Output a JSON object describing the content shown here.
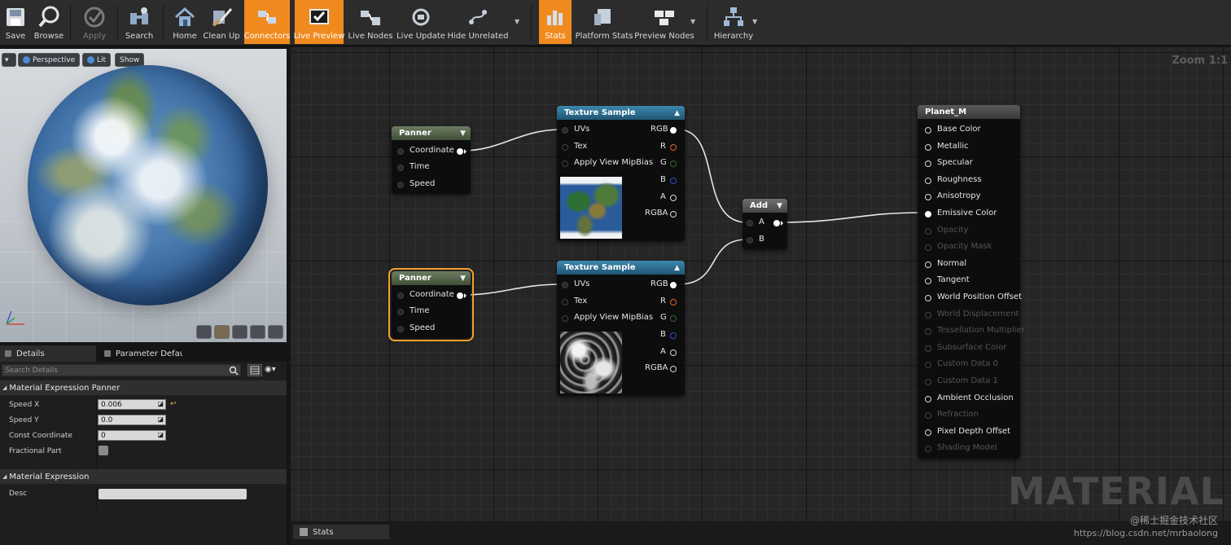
{
  "toolbar": {
    "items": [
      {
        "label": "Save",
        "icon": "save-icon"
      },
      {
        "label": "Browse",
        "icon": "browse-icon"
      },
      {
        "label": "Apply",
        "icon": "apply-icon"
      },
      {
        "label": "Search",
        "icon": "search-icon"
      },
      {
        "label": "Home",
        "icon": "home-icon"
      },
      {
        "label": "Clean Up",
        "icon": "clean-up-icon"
      },
      {
        "label": "Connectors",
        "icon": "connectors-icon"
      },
      {
        "label": "Live Preview",
        "icon": "live-preview-icon"
      },
      {
        "label": "Live Nodes",
        "icon": "live-nodes-icon"
      },
      {
        "label": "Live Update",
        "icon": "live-update-icon"
      },
      {
        "label": "Hide Unrelated",
        "icon": "hide-unrelated-icon"
      },
      {
        "label": "Stats",
        "icon": "stats-icon"
      },
      {
        "label": "Platform Stats",
        "icon": "platform-stats-icon"
      },
      {
        "label": "Preview Nodes",
        "icon": "preview-nodes-icon"
      },
      {
        "label": "Hierarchy",
        "icon": "hierarchy-icon"
      }
    ],
    "accent": "#f08a1e"
  },
  "viewport": {
    "perspective": "Perspective",
    "lit": "Lit",
    "show": "Show"
  },
  "details": {
    "tab_details": "Details",
    "tab_params": "Parameter Defaults",
    "search_placeholder": "Search Details",
    "section1": "Material Expression Panner",
    "props": [
      {
        "name": "Speed X",
        "value": "0.006"
      },
      {
        "name": "Speed Y",
        "value": "0.0"
      },
      {
        "name": "Const Coordinate",
        "value": "0"
      },
      {
        "name": "Fractional Part",
        "value": ""
      }
    ],
    "section2": "Material Expression",
    "desc_label": "Desc"
  },
  "graph": {
    "zoom": "Zoom 1:1",
    "watermark": "MATERIAL",
    "panner1": {
      "title": "Panner",
      "pins": [
        "Coordinate",
        "Time",
        "Speed"
      ]
    },
    "panner2": {
      "title": "Panner",
      "pins": [
        "Coordinate",
        "Time",
        "Speed"
      ]
    },
    "tex1": {
      "title": "Texture Sample",
      "inputs": [
        "UVs",
        "Tex",
        "Apply View MipBias"
      ],
      "outputs": [
        "RGB",
        "R",
        "G",
        "B",
        "A",
        "RGBA"
      ]
    },
    "tex2": {
      "title": "Texture Sample",
      "inputs": [
        "UVs",
        "Tex",
        "Apply View MipBias"
      ],
      "outputs": [
        "RGB",
        "R",
        "G",
        "B",
        "A",
        "RGBA"
      ]
    },
    "add": {
      "title": "Add",
      "inputs": [
        "A",
        "B"
      ]
    },
    "result": {
      "title": "Planet_M",
      "pins": [
        {
          "label": "Base Color",
          "enabled": true
        },
        {
          "label": "Metallic",
          "enabled": true
        },
        {
          "label": "Specular",
          "enabled": true
        },
        {
          "label": "Roughness",
          "enabled": true
        },
        {
          "label": "Anisotropy",
          "enabled": true
        },
        {
          "label": "Emissive Color",
          "enabled": true
        },
        {
          "label": "Opacity",
          "enabled": false
        },
        {
          "label": "Opacity Mask",
          "enabled": false
        },
        {
          "label": "Normal",
          "enabled": true
        },
        {
          "label": "Tangent",
          "enabled": true
        },
        {
          "label": "World Position Offset",
          "enabled": true
        },
        {
          "label": "World Displacement",
          "enabled": false
        },
        {
          "label": "Tessellation Multiplier",
          "enabled": false
        },
        {
          "label": "Subsurface Color",
          "enabled": false
        },
        {
          "label": "Custom Data 0",
          "enabled": false
        },
        {
          "label": "Custom Data 1",
          "enabled": false
        },
        {
          "label": "Ambient Occlusion",
          "enabled": true
        },
        {
          "label": "Refraction",
          "enabled": false
        },
        {
          "label": "Pixel Depth Offset",
          "enabled": true
        },
        {
          "label": "Shading Model",
          "enabled": false
        }
      ]
    }
  },
  "stats_tab": "Stats",
  "caption1": "@稀土掘金技术社区",
  "caption2": "https://blog.csdn.net/mrbaolong"
}
